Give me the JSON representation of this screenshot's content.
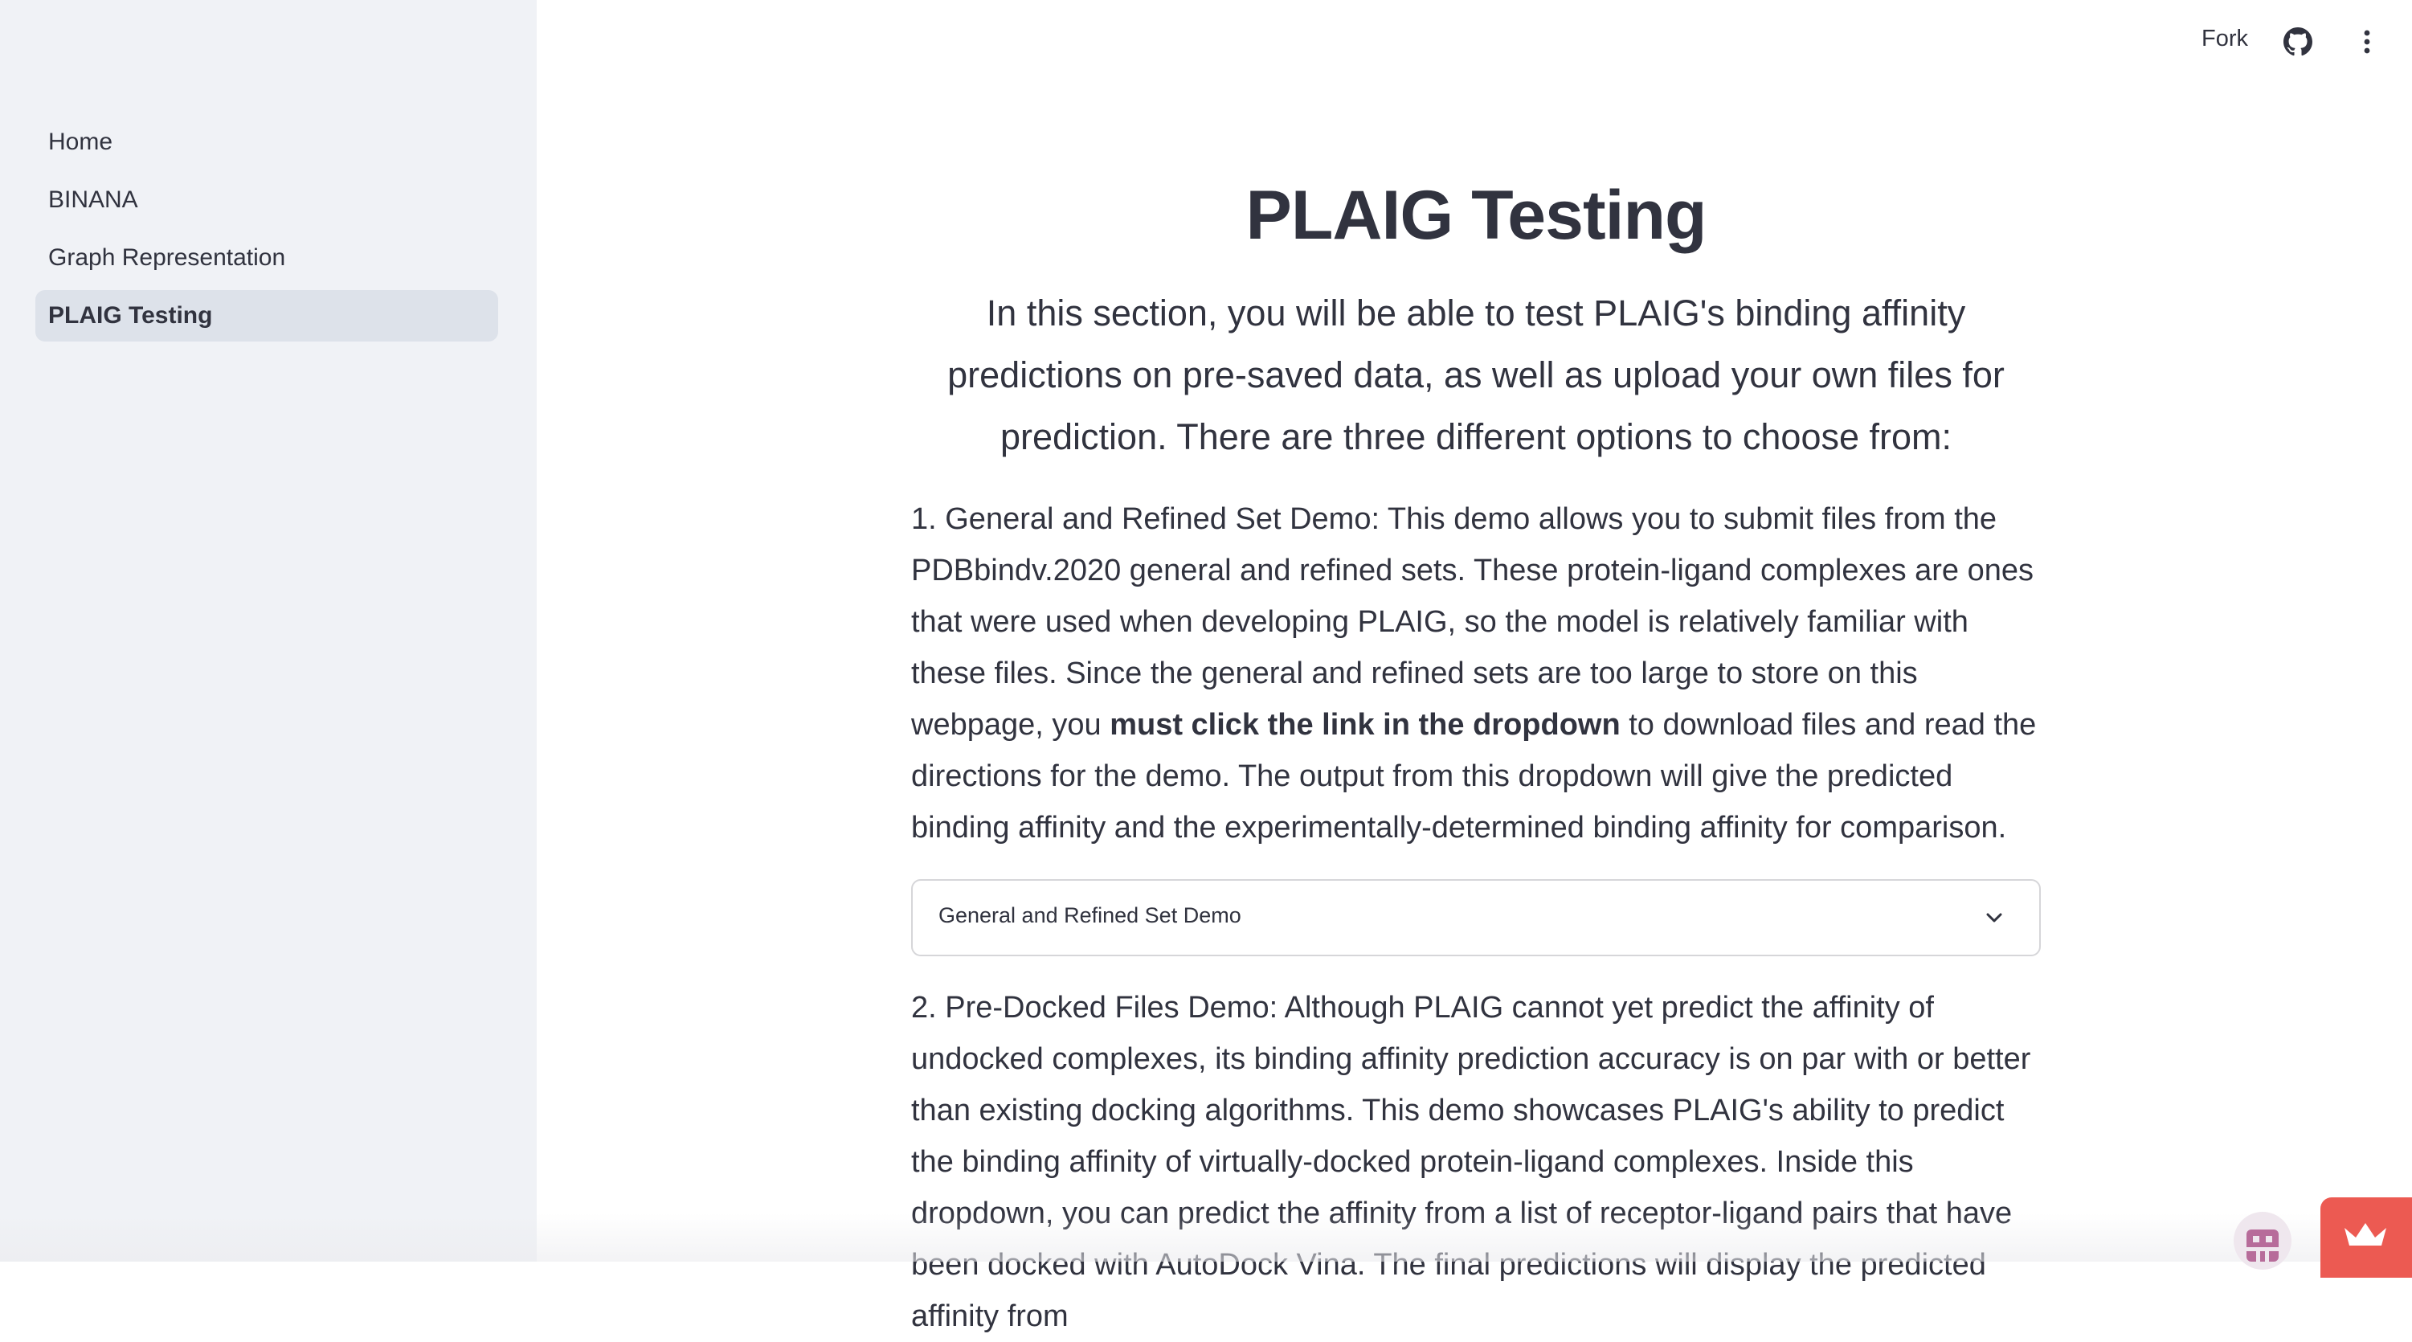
{
  "sidebar": {
    "items": [
      {
        "label": "Home",
        "active": false
      },
      {
        "label": "BINANA",
        "active": false
      },
      {
        "label": "Graph Representation",
        "active": false
      },
      {
        "label": "PLAIG Testing",
        "active": true
      }
    ]
  },
  "toolbar": {
    "fork_label": "Fork",
    "github_icon": "github-icon",
    "menu_icon": "kebab-menu-icon"
  },
  "main": {
    "title": "PLAIG Testing",
    "intro": "In this section, you will be able to test PLAIG's binding affinity predictions on pre-saved data, as well as upload your own files for prediction. There are three different options to choose from:",
    "para1_before": "1. General and Refined Set Demo: This demo allows you to submit files from the PDBbindv.2020 general and refined sets. These protein-ligand complexes are ones that were used when developing PLAIG, so the model is relatively familiar with these files. Since the general and refined sets are too large to store on this webpage, you ",
    "para1_bold": "must click the link in the dropdown",
    "para1_after": " to download files and read the directions for the demo. The output from this dropdown will give the predicted binding affinity and the experimentally-determined binding affinity for comparison.",
    "dropdown_label": "General and Refined Set Demo",
    "para2": "2. Pre-Docked Files Demo: Although PLAIG cannot yet predict the affinity of undocked complexes, its binding affinity prediction accuracy is on par with or better than existing docking algorithms. This demo showcases PLAIG's ability to predict the binding affinity of virtually-docked protein-ligand complexes. Inside this dropdown, you can predict the affinity from a list of receptor-ligand pairs that have been docked with AutoDock Vina. The final predictions will display the predicted affinity from"
  },
  "colors": {
    "sidebar_bg": "#f0f2f6",
    "active_item_bg": "#dde2ea",
    "text": "#31333f",
    "badge_red": "#ec5a52"
  }
}
